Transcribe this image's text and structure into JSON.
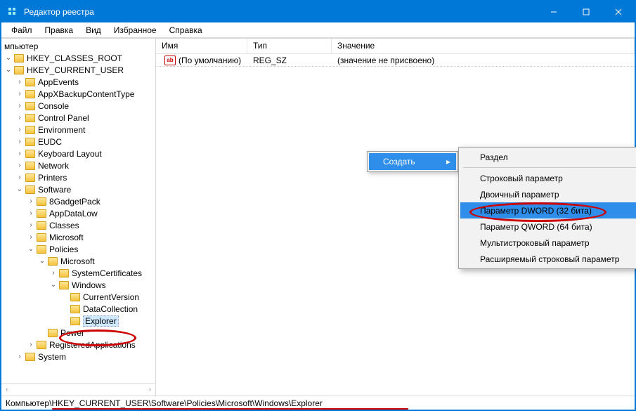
{
  "window": {
    "title": "Редактор реестра"
  },
  "menubar": [
    "Файл",
    "Правка",
    "Вид",
    "Избранное",
    "Справка"
  ],
  "tree": {
    "root_label": "мпьютер",
    "nodes": [
      {
        "depth": 0,
        "exp": "open",
        "label": "HKEY_CLASSES_ROOT"
      },
      {
        "depth": 0,
        "exp": "open",
        "label": "HKEY_CURRENT_USER"
      },
      {
        "depth": 1,
        "exp": "closed",
        "label": "AppEvents"
      },
      {
        "depth": 1,
        "exp": "closed",
        "label": "AppXBackupContentType"
      },
      {
        "depth": 1,
        "exp": "closed",
        "label": "Console"
      },
      {
        "depth": 1,
        "exp": "closed",
        "label": "Control Panel"
      },
      {
        "depth": 1,
        "exp": "closed",
        "label": "Environment"
      },
      {
        "depth": 1,
        "exp": "closed",
        "label": "EUDC"
      },
      {
        "depth": 1,
        "exp": "closed",
        "label": "Keyboard Layout"
      },
      {
        "depth": 1,
        "exp": "closed",
        "label": "Network"
      },
      {
        "depth": 1,
        "exp": "closed",
        "label": "Printers"
      },
      {
        "depth": 1,
        "exp": "open",
        "label": "Software"
      },
      {
        "depth": 2,
        "exp": "closed",
        "label": "8GadgetPack"
      },
      {
        "depth": 2,
        "exp": "closed",
        "label": "AppDataLow"
      },
      {
        "depth": 2,
        "exp": "closed",
        "label": "Classes"
      },
      {
        "depth": 2,
        "exp": "closed",
        "label": "Microsoft"
      },
      {
        "depth": 2,
        "exp": "open",
        "label": "Policies"
      },
      {
        "depth": 3,
        "exp": "open",
        "label": "Microsoft"
      },
      {
        "depth": 4,
        "exp": "closed",
        "label": "SystemCertificates"
      },
      {
        "depth": 4,
        "exp": "open",
        "label": "Windows"
      },
      {
        "depth": 5,
        "exp": "none",
        "label": "CurrentVersion"
      },
      {
        "depth": 5,
        "exp": "none",
        "label": "DataCollection"
      },
      {
        "depth": 5,
        "exp": "none",
        "label": "Explorer",
        "selected": true
      },
      {
        "depth": 3,
        "exp": "none",
        "label": "Power"
      },
      {
        "depth": 2,
        "exp": "closed",
        "label": "RegisteredApplications"
      },
      {
        "depth": 1,
        "exp": "closed",
        "label": "System"
      }
    ]
  },
  "columns": {
    "name": "Имя",
    "type": "Тип",
    "value": "Значение"
  },
  "rows": [
    {
      "icon": "ab",
      "name": "(По умолчанию)",
      "type": "REG_SZ",
      "value": "(значение не присвоено)"
    }
  ],
  "context_parent": {
    "label": "Создать"
  },
  "context_sub": [
    {
      "label": "Раздел",
      "sep_after": true
    },
    {
      "label": "Строковый параметр"
    },
    {
      "label": "Двоичный параметр"
    },
    {
      "label": "Параметр DWORD (32 бита)",
      "highlight": true
    },
    {
      "label": "Параметр QWORD (64 бита)"
    },
    {
      "label": "Мультистроковый параметр"
    },
    {
      "label": "Расширяемый строковый параметр"
    }
  ],
  "statusbar": "Компьютер\\HKEY_CURRENT_USER\\Software\\Policies\\Microsoft\\Windows\\Explorer"
}
